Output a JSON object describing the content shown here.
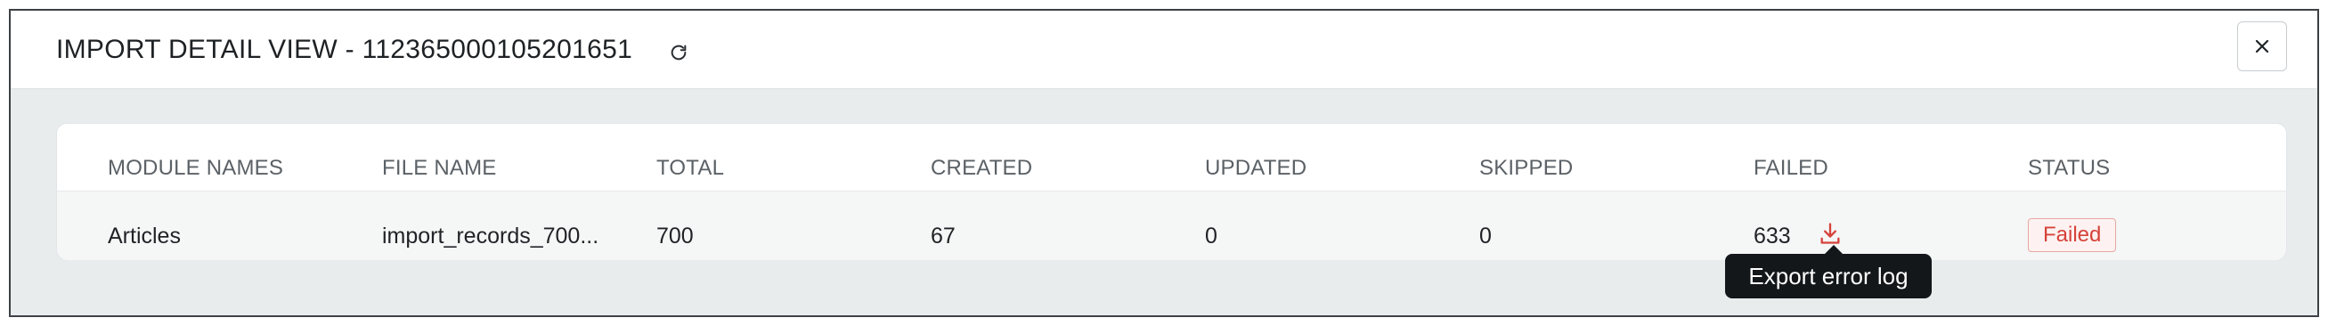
{
  "dialog": {
    "title": "IMPORT DETAIL VIEW - 112365000105201651",
    "refresh_icon": "refresh-icon",
    "close_icon": "close-icon"
  },
  "table": {
    "headers": [
      "MODULE NAMES",
      "FILE NAME",
      "TOTAL",
      "CREATED",
      "UPDATED",
      "SKIPPED",
      "FAILED",
      "STATUS"
    ],
    "rows": [
      {
        "module_name": "Articles",
        "file_name": "import_records_700...",
        "total": "700",
        "created": "67",
        "updated": "0",
        "skipped": "0",
        "failed": "633",
        "status": "Failed"
      }
    ]
  },
  "failed_download_icon": "download-icon",
  "tooltip": {
    "text": "Export error log"
  },
  "colors": {
    "status_failed_text": "#d6423a",
    "status_failed_border": "#e8a7a3",
    "download_icon": "#d6423a",
    "tooltip_bg": "#14171a",
    "backdrop": "#e9eced"
  }
}
